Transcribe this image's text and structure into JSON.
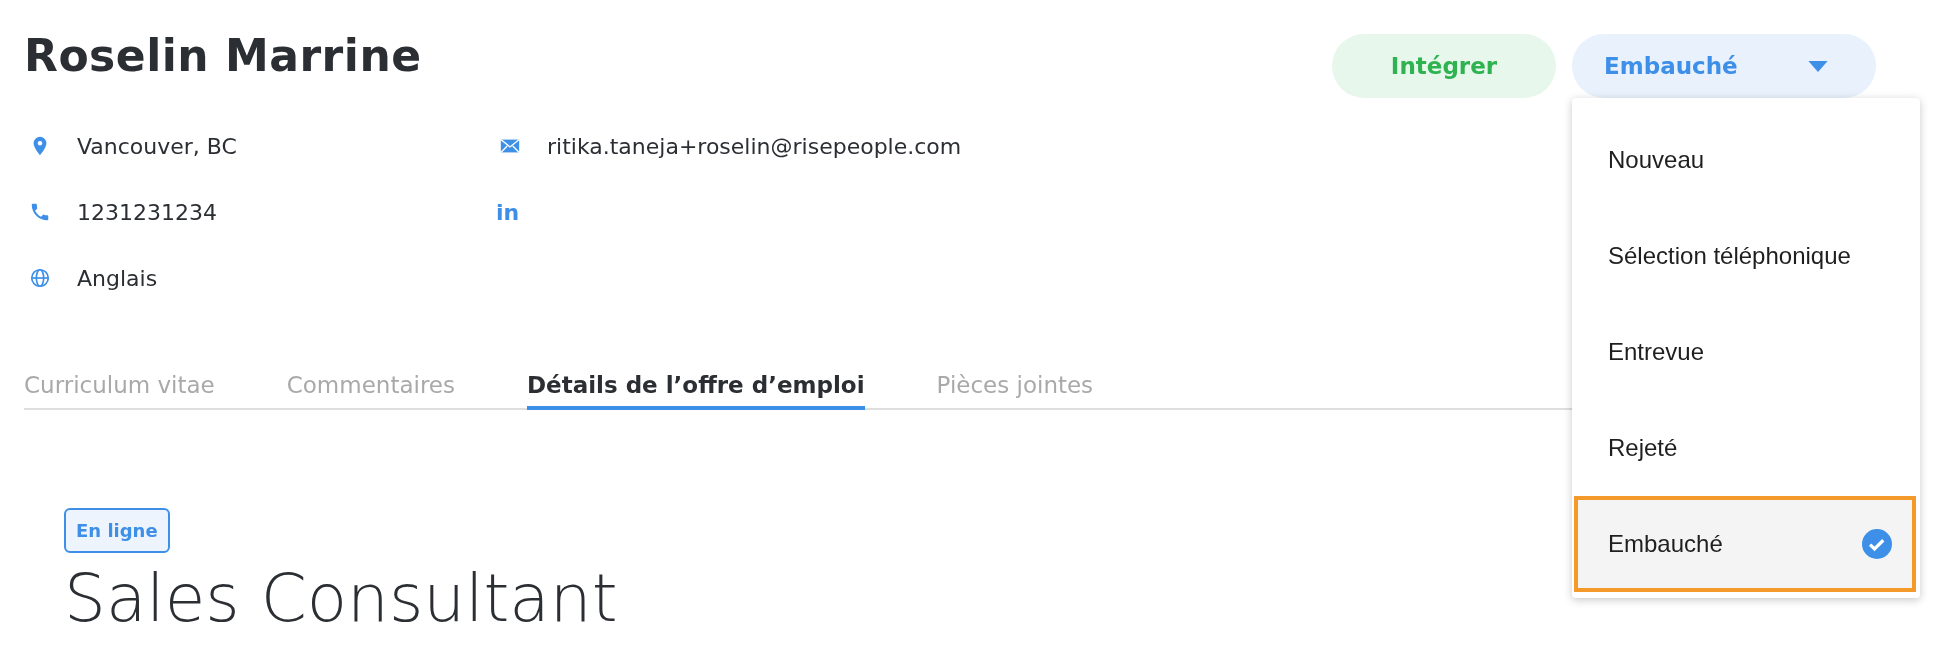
{
  "candidate": {
    "name": "Roselin Marrine",
    "info_left": [
      {
        "kind": "location",
        "text": "Vancouver, BC"
      },
      {
        "kind": "phone",
        "text": "1231231234"
      },
      {
        "kind": "language",
        "text": "Anglais"
      }
    ],
    "info_right": [
      {
        "kind": "email",
        "text": "ritika.taneja+roselin@risepeople.com"
      },
      {
        "kind": "linkedin",
        "text": "in"
      }
    ]
  },
  "actions": {
    "primary": "Intégrer",
    "status": "Embauché"
  },
  "status_menu": [
    {
      "label": "Nouveau",
      "selected": false
    },
    {
      "label": "Sélection téléphonique",
      "selected": false
    },
    {
      "label": "Entrevue",
      "selected": false
    },
    {
      "label": "Rejeté",
      "selected": false
    },
    {
      "label": "Embauché",
      "selected": true
    }
  ],
  "tabs": [
    {
      "label": "Curriculum vitae",
      "selected": false
    },
    {
      "label": "Commentaires",
      "selected": false
    },
    {
      "label": "Détails de l’offre d’emploi",
      "selected": true
    },
    {
      "label": "Pièces jointes",
      "selected": false
    }
  ],
  "job": {
    "badge": "En ligne",
    "title": "Sales Consultant"
  }
}
